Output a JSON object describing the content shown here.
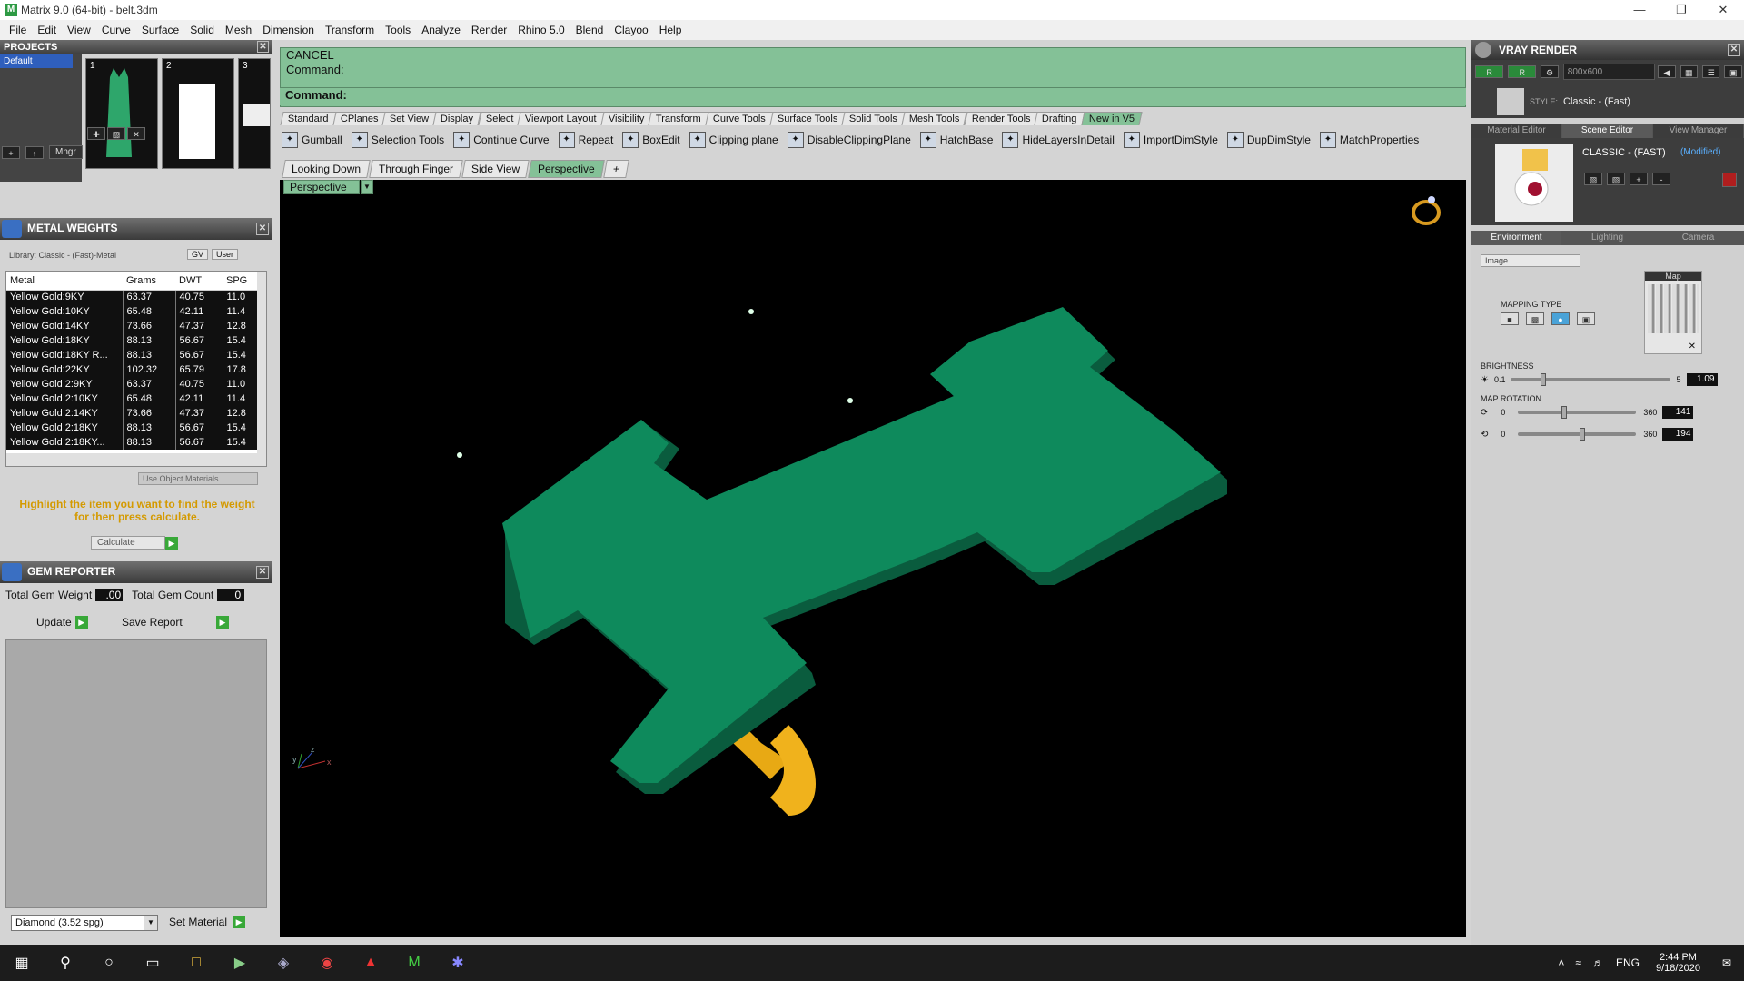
{
  "window": {
    "title": "Matrix 9.0 (64-bit) - belt.3dm",
    "app_icon": "matrix-app-icon"
  },
  "menu": [
    "File",
    "Edit",
    "View",
    "Curve",
    "Surface",
    "Solid",
    "Mesh",
    "Dimension",
    "Transform",
    "Tools",
    "Analyze",
    "Render",
    "Rhino 5.0",
    "Blend",
    "Clayoo",
    "Help"
  ],
  "projects": {
    "title": "PROJECTS",
    "items": [
      "Default"
    ],
    "thumb_numbers": [
      "1",
      "2",
      "3"
    ],
    "mngr_label": "Mngr"
  },
  "metal_weights": {
    "title": "METAL WEIGHTS",
    "library": "Library: Classic - (Fast)-Metal",
    "gv_label": "GV",
    "user_label": "User",
    "columns": [
      "Metal",
      "Grams",
      "DWT",
      "SPG"
    ],
    "rows": [
      [
        "Yellow Gold:9KY",
        "63.37",
        "40.75",
        "11.0"
      ],
      [
        "Yellow Gold:10KY",
        "65.48",
        "42.11",
        "11.4"
      ],
      [
        "Yellow Gold:14KY",
        "73.66",
        "47.37",
        "12.8"
      ],
      [
        "Yellow Gold:18KY",
        "88.13",
        "56.67",
        "15.4"
      ],
      [
        "Yellow Gold:18KY R...",
        "88.13",
        "56.67",
        "15.4"
      ],
      [
        "Yellow Gold:22KY",
        "102.32",
        "65.79",
        "17.8"
      ],
      [
        "Yellow Gold 2:9KY",
        "63.37",
        "40.75",
        "11.0"
      ],
      [
        "Yellow Gold 2:10KY",
        "65.48",
        "42.11",
        "11.4"
      ],
      [
        "Yellow Gold 2:14KY",
        "73.66",
        "47.37",
        "12.8"
      ],
      [
        "Yellow Gold 2:18KY",
        "88.13",
        "56.67",
        "15.4"
      ],
      [
        "Yellow Gold 2:18KY...",
        "88.13",
        "56.67",
        "15.4"
      ]
    ],
    "use_object_materials": "Use Object Materials",
    "hint": "Highlight the item you want to find the weight for then press calculate.",
    "calculate_label": "Calculate"
  },
  "gem_reporter": {
    "title": "GEM REPORTER",
    "total_weight_label": "Total Gem Weight",
    "total_weight_value": ".00",
    "total_count_label": "Total Gem Count",
    "total_count_value": "0",
    "update_label": "Update",
    "save_label": "Save Report",
    "material_select": "Diamond      (3.52 spg)",
    "set_material_label": "Set Material"
  },
  "command": {
    "cancel": "CANCEL",
    "prompt": "Command:",
    "input_label": "Command:"
  },
  "toolbar_tabs": [
    "Standard",
    "CPlanes",
    "Set View",
    "Display",
    "Select",
    "Viewport Layout",
    "Visibility",
    "Transform",
    "Curve Tools",
    "Surface Tools",
    "Solid Tools",
    "Mesh Tools",
    "Render Tools",
    "Drafting",
    "New in V5"
  ],
  "tools": [
    "Gumball",
    "Selection Tools",
    "Continue Curve",
    "Repeat",
    "BoxEdit",
    "Clipping plane",
    "DisableClippingPlane",
    "HatchBase",
    "HideLayersInDetail",
    "ImportDimStyle",
    "DupDimStyle",
    "MatchProperties"
  ],
  "view_tabs": [
    "Looking Down",
    "Through Finger",
    "Side View",
    "Perspective"
  ],
  "viewport_label": "Perspective",
  "vray": {
    "title": "VRAY RENDER",
    "resolution": "800x600",
    "style_prefix": "STYLE:",
    "style": "Classic - (Fast)",
    "tabs": [
      "Material Editor",
      "Scene Editor",
      "View Manager"
    ],
    "scene_name": "CLASSIC - (FAST)",
    "scene_modified": "(Modified)",
    "env_tabs": [
      "Environment",
      "Lighting",
      "Camera"
    ],
    "image_select": "Image",
    "map_label": "Map",
    "mapping_type": "MAPPING TYPE",
    "brightness_label": "BRIGHTNESS",
    "brightness": {
      "min": "0.1",
      "max": "5",
      "value": "1.09",
      "fraction": 0.2
    },
    "map_rotation_label": "MAP ROTATION",
    "rot1": {
      "min": "0",
      "max": "360",
      "value": "141",
      "fraction": 0.39
    },
    "rot2": {
      "min": "0",
      "max": "360",
      "value": "194",
      "fraction": 0.54
    }
  },
  "taskbar": {
    "lang": "ENG",
    "time": "2:44 PM",
    "date": "9/18/2020"
  },
  "colors": {
    "command_green": "#84c197",
    "model_green": "#0e8a5c",
    "model_gold": "#f0b21c",
    "hint_orange": "#d49a00"
  }
}
